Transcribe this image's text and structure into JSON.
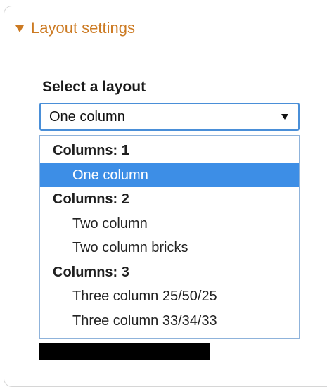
{
  "settings": {
    "summary_label": "Layout settings",
    "field_label": "Select a layout",
    "selected_value": "One column",
    "groups": [
      {
        "label": "Columns: 1",
        "options": [
          {
            "label": "One column",
            "selected": true
          }
        ]
      },
      {
        "label": "Columns: 2",
        "options": [
          {
            "label": "Two column",
            "selected": false
          },
          {
            "label": "Two column bricks",
            "selected": false
          }
        ]
      },
      {
        "label": "Columns: 3",
        "options": [
          {
            "label": "Three column 25/50/25",
            "selected": false
          },
          {
            "label": "Three column 33/34/33",
            "selected": false
          }
        ]
      }
    ]
  },
  "colors": {
    "summary": "#cc7a22",
    "select_border": "#4a8fd8",
    "highlight": "#3d8ee6"
  },
  "icons": {
    "summary_toggle": "triangle-down-icon",
    "select_caret": "caret-down-icon"
  }
}
